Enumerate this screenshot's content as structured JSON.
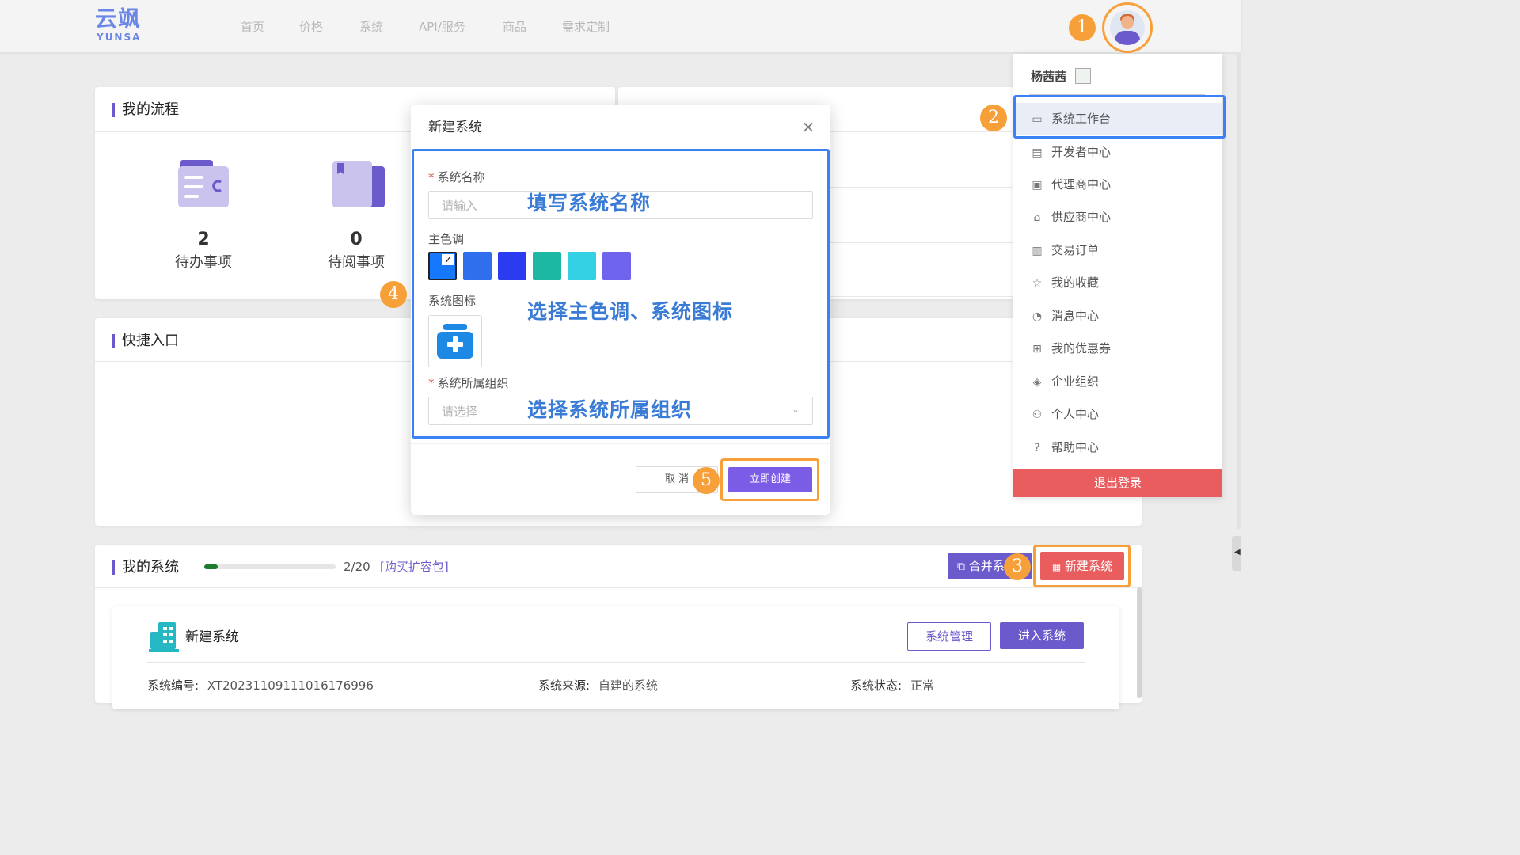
{
  "logo": {
    "cn": "云飒",
    "en": "YUNSA"
  },
  "nav": {
    "items": [
      "首页",
      "价格",
      "系统",
      "API/服务",
      "商品",
      "需求定制"
    ]
  },
  "badges": [
    "1",
    "2",
    "3",
    "4",
    "5"
  ],
  "flow": {
    "title": "我的流程",
    "stats": [
      {
        "value": "2",
        "label": "待办事项"
      },
      {
        "value": "0",
        "label": "待阅事项"
      }
    ]
  },
  "quick": {
    "title": "快捷入口"
  },
  "menu": {
    "username": "杨茜茜",
    "items": [
      {
        "icon": "monitor-icon",
        "label": "系统工作台"
      },
      {
        "icon": "developer-icon",
        "label": "开发者中心"
      },
      {
        "icon": "briefcase-icon",
        "label": "代理商中心"
      },
      {
        "icon": "store-icon",
        "label": "供应商中心"
      },
      {
        "icon": "document-icon",
        "label": "交易订单"
      },
      {
        "icon": "star-icon",
        "label": "我的收藏"
      },
      {
        "icon": "bell-icon",
        "label": "消息中心"
      },
      {
        "icon": "gift-icon",
        "label": "我的优惠券"
      },
      {
        "icon": "layers-icon",
        "label": "企业组织"
      },
      {
        "icon": "user-icon",
        "label": "个人中心"
      },
      {
        "icon": "help-icon",
        "label": "帮助中心"
      }
    ],
    "logout": "退出登录"
  },
  "systems": {
    "title": "我的系统",
    "quota": {
      "used": 2,
      "total": 20,
      "text": "2/20"
    },
    "buy_link": "[购买扩容包]",
    "merge_button": "合并系",
    "new_button": "新建系统",
    "card": {
      "name": "新建系统",
      "manage_button": "系统管理",
      "enter_button": "进入系统",
      "fields": [
        {
          "label": "系统编号:",
          "value": "XT20231109111016176996"
        },
        {
          "label": "系统来源:",
          "value": "自建的系统"
        },
        {
          "label": "系统状态:",
          "value": "正常"
        }
      ]
    }
  },
  "modal": {
    "title": "新建系统",
    "name_label": "系统名称",
    "name_placeholder": "请输入",
    "name_annotation": "填写系统名称",
    "color_label": "主色调",
    "colors": [
      "#1677ff",
      "#2f6fee",
      "#2b3bf0",
      "#1db8a3",
      "#34d0e4",
      "#6f64ee"
    ],
    "icon_label": "系统图标",
    "icon_annotation": "选择主色调、系统图标",
    "org_label": "系统所属组织",
    "org_placeholder": "请选择",
    "org_annotation": "选择系统所属组织",
    "cancel": "取 消",
    "confirm": "立即创建"
  },
  "colors": {
    "accent": "#6b5acb",
    "highlight": "#3b82f6",
    "badge": "#f7a03a",
    "danger": "#e95d5f",
    "new_button": "#e95d5f",
    "confirm_button": "#7b5ce6"
  }
}
